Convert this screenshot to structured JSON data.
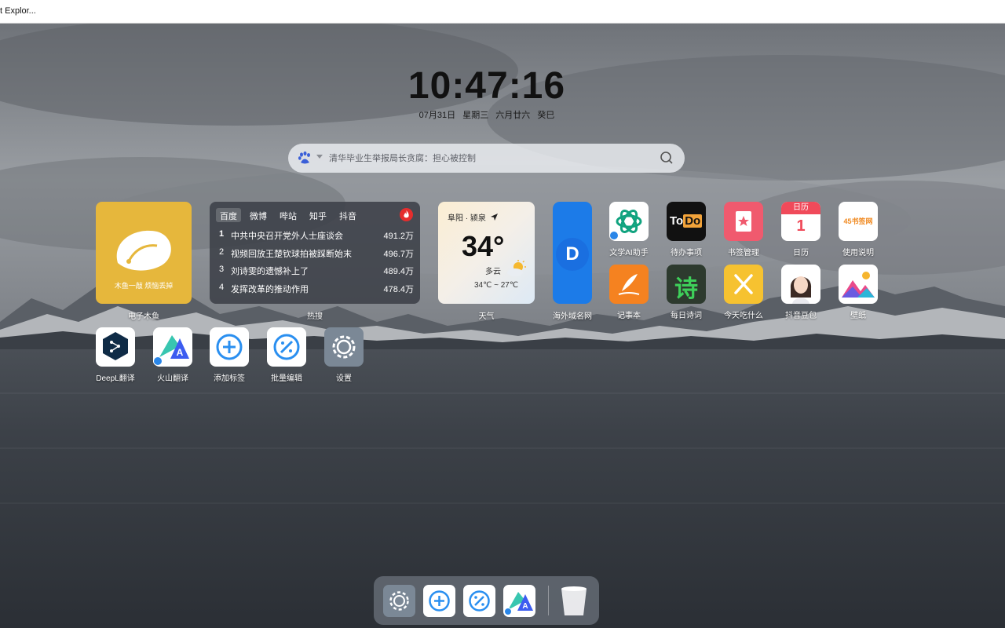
{
  "window": {
    "title": "t Explor..."
  },
  "clock": {
    "time": "10:47:16"
  },
  "date": {
    "day": "07月31日",
    "weekday": "星期三",
    "lunar": "六月廿六",
    "ganzhi": "癸巳"
  },
  "search": {
    "placeholder": "清华毕业生举报局长贪腐：担心被控制",
    "engine_icon": "baidu-paw-icon"
  },
  "widgets": {
    "muyu": {
      "label": "电子木鱼",
      "subtitle": "木鱼一敲 烦恼丢掉"
    },
    "hot": {
      "label": "热搜",
      "tabs": [
        "百度",
        "微博",
        "哔站",
        "知乎",
        "抖音"
      ],
      "active_tab": "百度",
      "items": [
        {
          "rank": "1",
          "title": "中共中央召开党外人士座谈会",
          "value": "491.2万"
        },
        {
          "rank": "2",
          "title": "视频回放王楚钦球拍被踩断始末",
          "value": "496.7万"
        },
        {
          "rank": "3",
          "title": "刘诗雯的遗憾补上了",
          "value": "489.4万"
        },
        {
          "rank": "4",
          "title": "发挥改革的推动作用",
          "value": "478.4万"
        }
      ]
    },
    "weather": {
      "label": "天气",
      "location": "阜阳 · 颍泉",
      "temp": "34°",
      "condition": "多云",
      "range": "34℃ ~ 27℃"
    },
    "domain": {
      "label": "海外域名网",
      "letter": "D"
    }
  },
  "apps": [
    {
      "label": "文学AI助手",
      "icon": "openai-icon"
    },
    {
      "label": "待办事项",
      "icon": "todo-icon",
      "text": "ToDo"
    },
    {
      "label": "书签管理",
      "icon": "bookmark-icon"
    },
    {
      "label": "日历",
      "icon": "calendar-icon",
      "head": "日历",
      "day": "1"
    },
    {
      "label": "使用说明",
      "icon": "guide-icon",
      "text": "45书签网"
    },
    {
      "label": "记事本",
      "icon": "notepad-icon"
    },
    {
      "label": "每日诗词",
      "icon": "poem-icon",
      "text": "诗"
    },
    {
      "label": "今天吃什么",
      "icon": "food-icon"
    },
    {
      "label": "抖音豆包",
      "icon": "doubao-icon"
    },
    {
      "label": "壁纸",
      "icon": "wallpaper-icon"
    },
    {
      "label": "DeepL翻译",
      "icon": "deepl-icon"
    },
    {
      "label": "火山翻译",
      "icon": "volcano-translate-icon"
    },
    {
      "label": "添加标签",
      "icon": "add-icon"
    },
    {
      "label": "批量编辑",
      "icon": "batch-edit-icon"
    },
    {
      "label": "设置",
      "icon": "settings-gear-icon"
    }
  ],
  "dock": [
    "settings-gear-icon",
    "add-icon",
    "batch-edit-icon",
    "volcano-translate-icon",
    "trash-icon"
  ],
  "colors": {
    "muyu": "#e6b73c",
    "hot_bg": "#3c4048",
    "fire": "#e52d2d",
    "domain": "#1c7be8",
    "accent_blue": "#2a86e8"
  }
}
